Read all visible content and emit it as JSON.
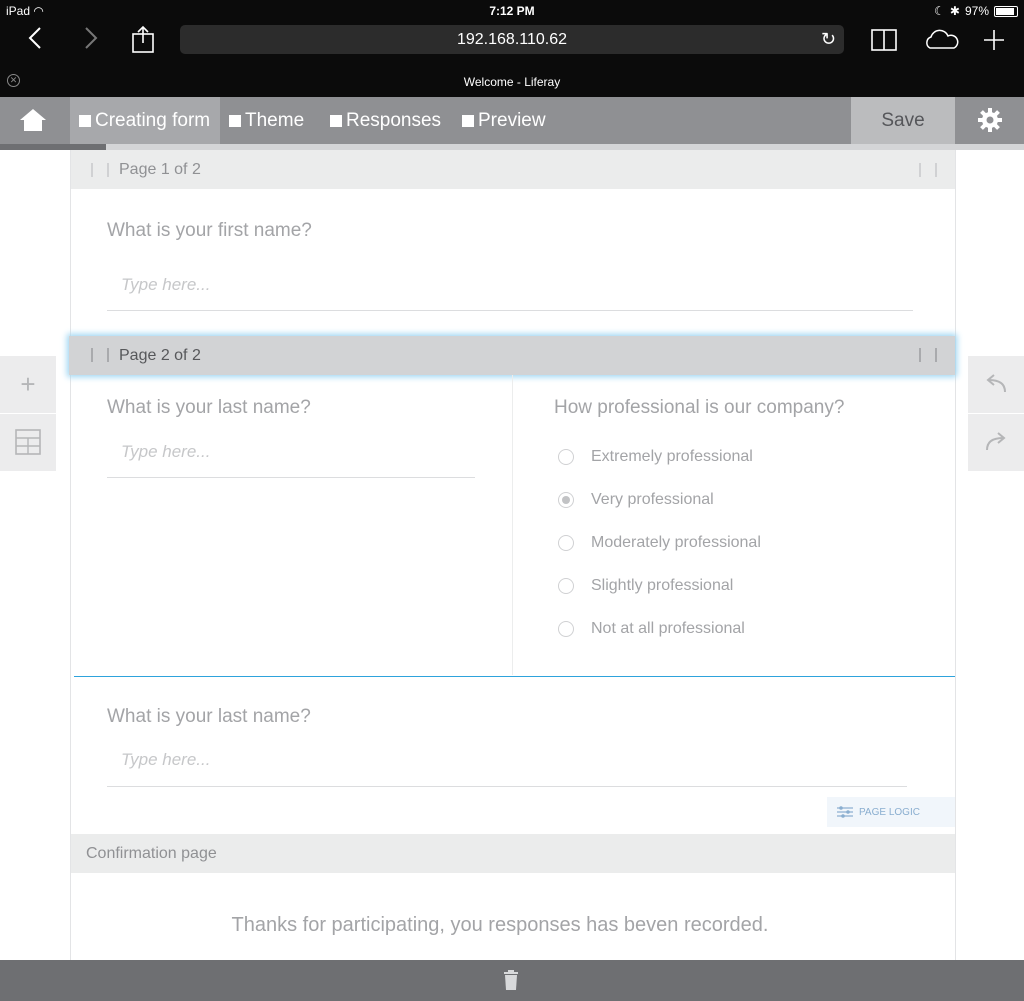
{
  "status_bar": {
    "carrier": "iPad",
    "time": "7:12 PM",
    "battery": "97%"
  },
  "browser": {
    "url": "192.168.110.62",
    "tab_title": "Welcome - Liferay"
  },
  "toolbar": {
    "tabs": [
      {
        "label": "Creating form"
      },
      {
        "label": "Theme"
      },
      {
        "label": "Responses"
      },
      {
        "label": "Preview"
      }
    ],
    "save_label": "Save",
    "progress": 0.104
  },
  "form": {
    "page1": {
      "header": "Page 1 of 2",
      "question": "What is your first name?",
      "placeholder": "Type here..."
    },
    "page2": {
      "header": "Page 2 of 2",
      "left_question": "What is your last name?",
      "left_placeholder": "Type here...",
      "right_question": "How professional is our company?",
      "options": [
        {
          "label": "Extremely professional"
        },
        {
          "label": "Very professional"
        },
        {
          "label": "Moderately professional"
        },
        {
          "label": "Slightly professional"
        },
        {
          "label": "Not at all professional"
        }
      ],
      "selected_option": "Very professional",
      "second_question": "What is your last name?",
      "second_placeholder": "Type here...",
      "page_logic_label": "PAGE LOGIC"
    },
    "confirmation": {
      "header": "Confirmation page",
      "message": "Thanks for participating, you responses has beven recorded."
    }
  },
  "colors": {
    "toolbar": "#8f9093",
    "accent_line": "#2ea3dc",
    "page_logic": "#8aaed0"
  }
}
